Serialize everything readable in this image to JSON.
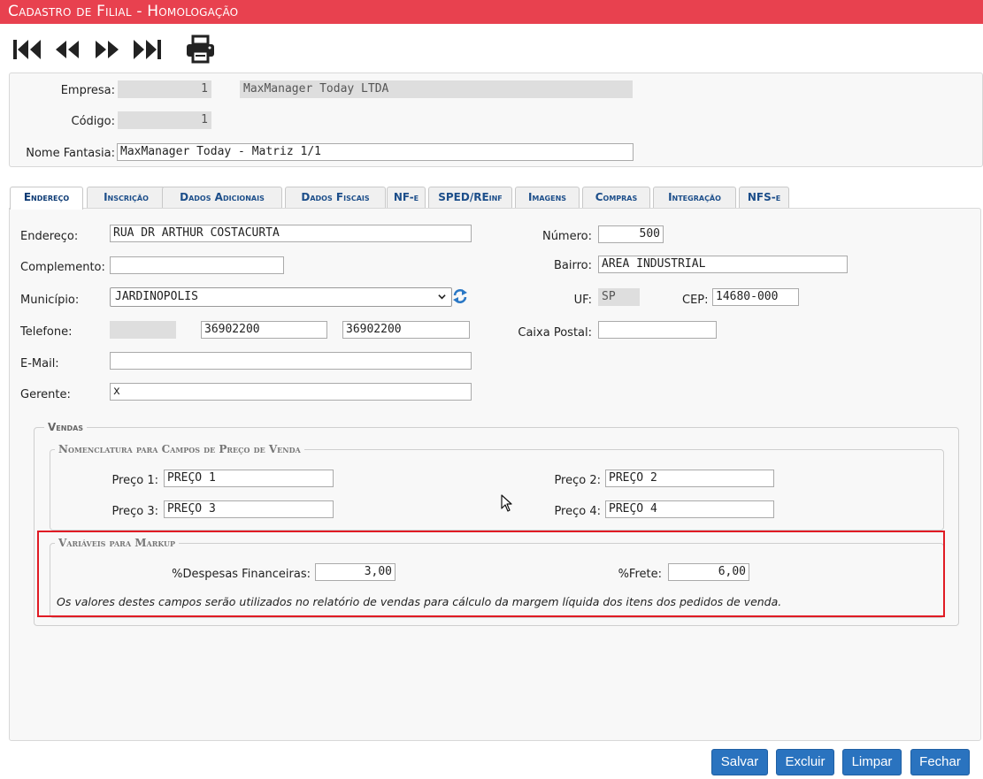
{
  "window": {
    "title": "Cadastro de Filial  - Homologação"
  },
  "toolbar": {
    "icons": [
      "first-record-icon",
      "previous-record-icon",
      "next-record-icon",
      "last-record-icon",
      "print-icon"
    ]
  },
  "header": {
    "empresa_label": "Empresa:",
    "empresa_code": "1",
    "empresa_name": "MaxManager Today LTDA",
    "codigo_label": "Código:",
    "codigo_value": "1",
    "nome_fantasia_label": "Nome Fantasia:",
    "nome_fantasia_value": "MaxManager Today - Matriz 1/1"
  },
  "tabs": [
    {
      "label": "Endereço",
      "active": true
    },
    {
      "label": "Inscrição",
      "active": false
    },
    {
      "label": "Dados Adicionais",
      "active": false
    },
    {
      "label": "Dados Fiscais",
      "active": false
    },
    {
      "label": "NF-e",
      "active": false
    },
    {
      "label": "SPED/REinf",
      "active": false
    },
    {
      "label": "Imagens",
      "active": false
    },
    {
      "label": "Compras",
      "active": false
    },
    {
      "label": "Integração",
      "active": false
    },
    {
      "label": "NFS-e",
      "active": false
    }
  ],
  "address": {
    "endereco_label": "Endereço:",
    "endereco_value": "RUA DR ARTHUR COSTACURTA",
    "numero_label": "Número:",
    "numero_value": "500",
    "complemento_label": "Complemento:",
    "complemento_value": "",
    "bairro_label": "Bairro:",
    "bairro_value": "AREA INDUSTRIAL",
    "municipio_label": "Município:",
    "municipio_value": "JARDINOPOLIS",
    "uf_label": "UF:",
    "uf_value": "SP",
    "cep_label": "CEP:",
    "cep_value": "14680-000",
    "telefone_label": "Telefone:",
    "telefone_ddd": "",
    "telefone_1": "36902200",
    "telefone_2": "36902200",
    "caixa_postal_label": "Caixa Postal:",
    "caixa_postal_value": "",
    "email_label": "E-Mail:",
    "email_value": "",
    "gerente_label": "Gerente:",
    "gerente_value": "x"
  },
  "vendas": {
    "legend": "Vendas",
    "nomenclatura_legend": "Nomenclatura para Campos de Preço de Venda",
    "preco1_label": "Preço 1:",
    "preco1_value": "PREÇO 1",
    "preco2_label": "Preço 2:",
    "preco2_value": "PREÇO 2",
    "preco3_label": "Preço 3:",
    "preco3_value": "PREÇO 3",
    "preco4_label": "Preço 4:",
    "preco4_value": "PREÇO 4",
    "markup_legend": "Variáveis para Markup",
    "despesas_label": "%Despesas Financeiras:",
    "despesas_value": "3,00",
    "frete_label": "%Frete:",
    "frete_value": "6,00",
    "note": "Os valores destes campos serão utilizados no relatório de vendas para cálculo da margem líquida dos itens dos pedidos de venda."
  },
  "buttons": {
    "salvar": "Salvar",
    "excluir": "Excluir",
    "limpar": "Limpar",
    "fechar": "Fechar"
  },
  "colors": {
    "titlebar": "#e8414f",
    "button": "#2a73bf",
    "highlight": "#e01b24",
    "tab_text": "#1c4e8a"
  }
}
